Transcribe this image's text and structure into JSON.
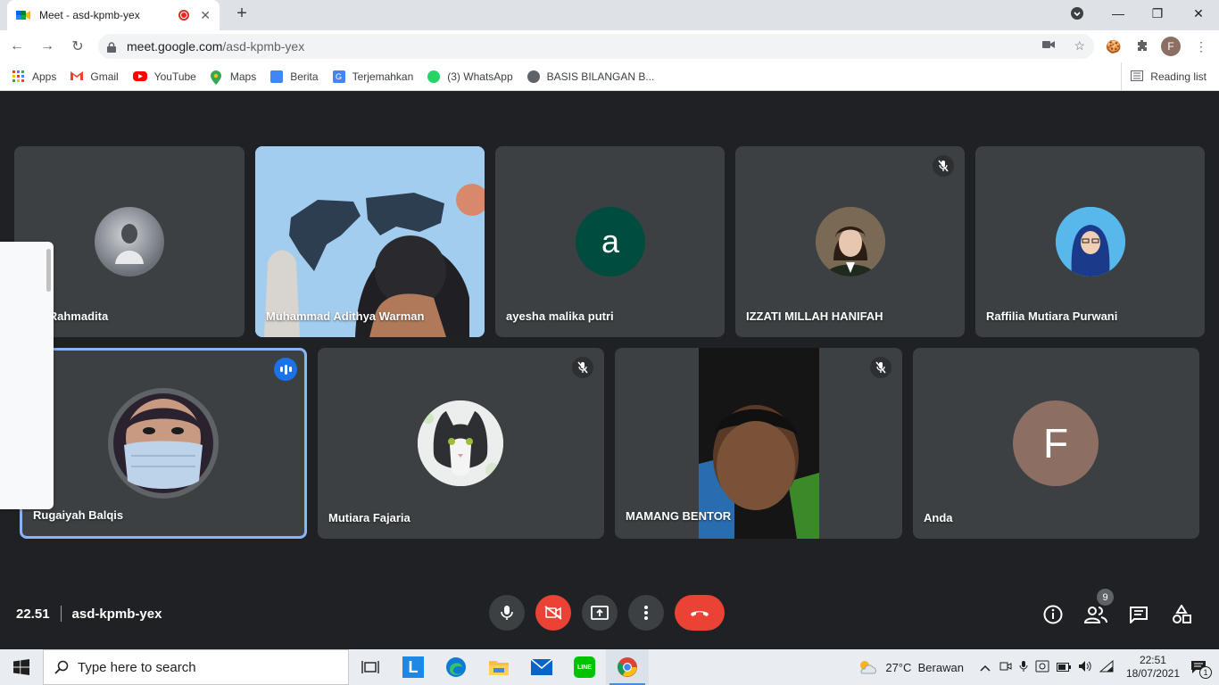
{
  "browser": {
    "tab_title": "Meet - asd-kpmb-yex",
    "url_host": "meet.google.com",
    "url_path": "/asd-kpmb-yex",
    "profile_initial": "F",
    "bookmarks": [
      {
        "label": "Apps",
        "color": "#ea4335"
      },
      {
        "label": "Gmail",
        "color": "#ea4335"
      },
      {
        "label": "YouTube",
        "color": "#ff0000"
      },
      {
        "label": "Maps",
        "color": "#34a853"
      },
      {
        "label": "Berita",
        "color": "#4285f4"
      },
      {
        "label": "Terjemahkan",
        "color": "#4285f4"
      },
      {
        "label": "(3) WhatsApp",
        "color": "#25d366"
      },
      {
        "label": "BASIS BILANGAN B...",
        "color": "#5f6368"
      }
    ],
    "reading_list": "Reading list"
  },
  "meet": {
    "participants": [
      {
        "name": "Dwi Rahmadita",
        "muted": false
      },
      {
        "name": "Muhammad Adithya Warman",
        "muted": false
      },
      {
        "name": "ayesha malika putri",
        "initial": "a",
        "avatar_color": "#004d40",
        "muted": false
      },
      {
        "name": "IZZATI MILLAH HANIFAH",
        "muted": true
      },
      {
        "name": "Raffilia Mutiara Purwani",
        "muted": false
      },
      {
        "name": "Rugaiyah Balqis",
        "speaking": true
      },
      {
        "name": "Mutiara Fajaria",
        "muted": true
      },
      {
        "name": "MAMANG BENTOR",
        "muted": true
      },
      {
        "name": "Anda",
        "initial": "F",
        "avatar_color": "#8d6e63",
        "muted": false
      }
    ],
    "time": "22.51",
    "meeting_code": "asd-kpmb-yex",
    "participant_count": "9",
    "accent_end_call": "#ea4335",
    "accent_speaking": "#8ab4f8"
  },
  "taskbar": {
    "search_placeholder": "Type here to search",
    "weather": "27°C  Berawan",
    "time": "22:51",
    "date": "18/07/2021",
    "notifications": "1"
  }
}
